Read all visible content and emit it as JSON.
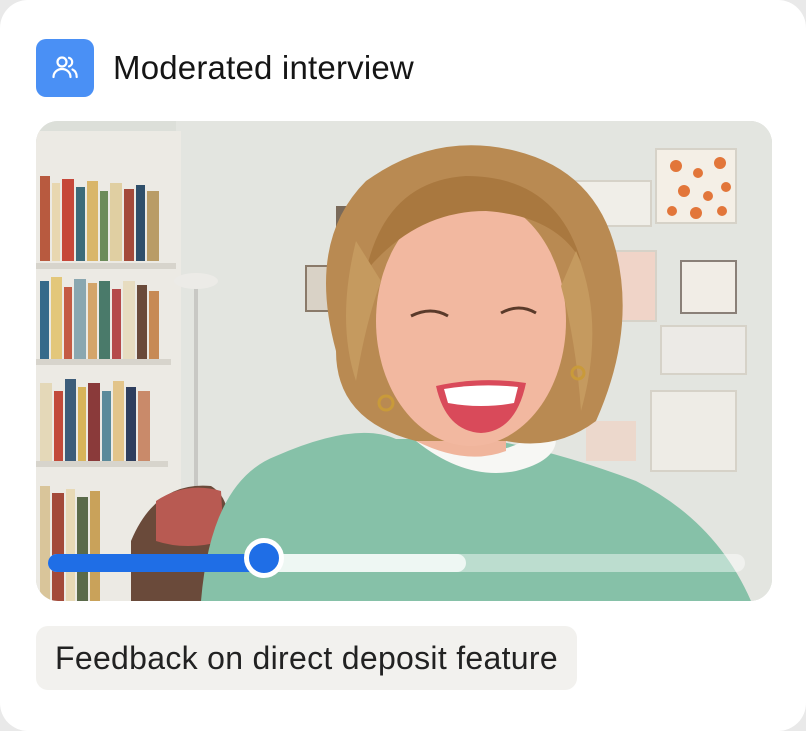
{
  "header": {
    "title": "Moderated interview",
    "icon": "users-icon",
    "icon_bg": "#4a90f5"
  },
  "video": {
    "progress_percent": 31,
    "buffered_percent": 60,
    "accent": "#1f6ee6"
  },
  "caption": {
    "text": "Feedback on direct deposit feature"
  }
}
